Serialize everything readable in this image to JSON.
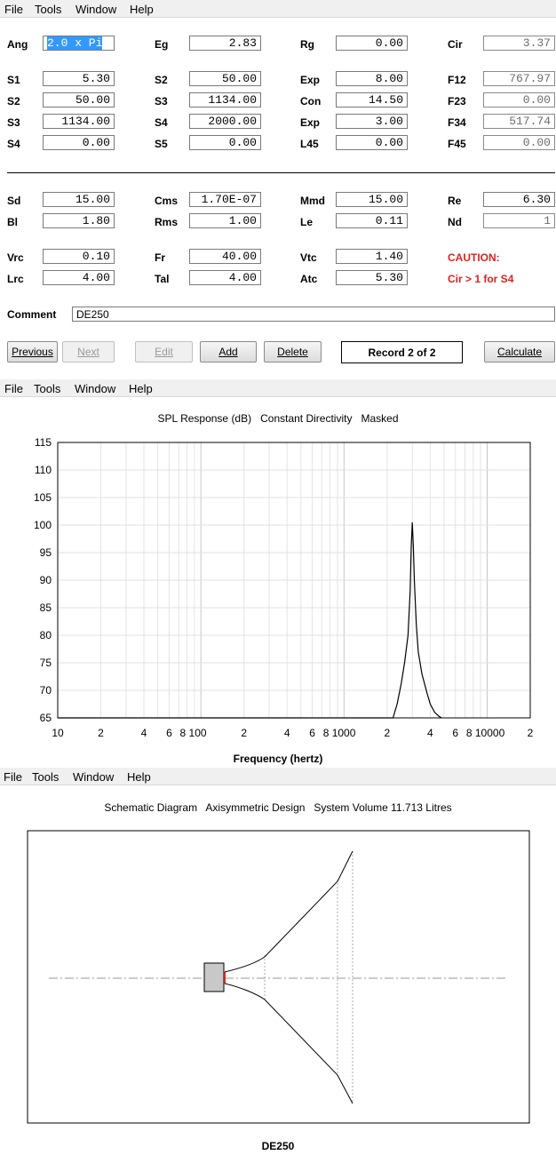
{
  "menu": {
    "file": "File",
    "tools": "Tools",
    "window": "Window",
    "help": "Help"
  },
  "form": {
    "rows": [
      [
        [
          "Ang",
          "2.0 x Pi"
        ],
        [
          "Eg",
          "2.83"
        ],
        [
          "Rg",
          "0.00"
        ],
        [
          "Cir",
          "3.37"
        ]
      ],
      [
        [
          "S1",
          "5.30"
        ],
        [
          "S2",
          "50.00"
        ],
        [
          "Exp",
          "8.00"
        ],
        [
          "F12",
          "767.97"
        ]
      ],
      [
        [
          "S2",
          "50.00"
        ],
        [
          "S3",
          "1134.00"
        ],
        [
          "Con",
          "14.50"
        ],
        [
          "F23",
          "0.00"
        ]
      ],
      [
        [
          "S3",
          "1134.00"
        ],
        [
          "S4",
          "2000.00"
        ],
        [
          "Exp",
          "3.00"
        ],
        [
          "F34",
          "517.74"
        ]
      ],
      [
        [
          "S4",
          "0.00"
        ],
        [
          "S5",
          "0.00"
        ],
        [
          "L45",
          "0.00"
        ],
        [
          "F45",
          "0.00"
        ]
      ],
      [
        [
          "Sd",
          "15.00"
        ],
        [
          "Cms",
          "1.70E-07"
        ],
        [
          "Mmd",
          "15.00"
        ],
        [
          "Re",
          "6.30"
        ]
      ],
      [
        [
          "Bl",
          "1.80"
        ],
        [
          "Rms",
          "1.00"
        ],
        [
          "Le",
          "0.11"
        ],
        [
          "Nd",
          "1"
        ]
      ],
      [
        [
          "Vrc",
          "0.10"
        ],
        [
          "Fr",
          "40.00"
        ],
        [
          "Vtc",
          "1.40"
        ]
      ],
      [
        [
          "Lrc",
          "4.00"
        ],
        [
          "Tal",
          "4.00"
        ],
        [
          "Atc",
          "5.30"
        ]
      ]
    ],
    "caution_title": "CAUTION:",
    "caution_msg": "Cir > 1 for S4",
    "comment_label": "Comment",
    "comment_value": "DE250",
    "buttons": {
      "previous": "Previous",
      "next": "Next",
      "edit": "Edit",
      "add": "Add",
      "delete": "Delete",
      "calculate": "Calculate"
    },
    "record": "Record 2 of 2"
  },
  "chart_data": {
    "type": "line",
    "title": "SPL Response (dB)   Constant Directivity   Masked",
    "xlabel": "Frequency (hertz)",
    "ylabel": "",
    "xscale": "log",
    "xlim": [
      10,
      20000
    ],
    "ylim": [
      65,
      115
    ],
    "ytick_labels": [
      "115",
      "110",
      "105",
      "100",
      "95",
      "90",
      "85",
      "80",
      "75",
      "70",
      "65"
    ],
    "yticks": [
      115,
      110,
      105,
      100,
      95,
      90,
      85,
      80,
      75,
      70,
      65
    ],
    "xtick_labels": [
      "10",
      "2",
      "4",
      "6",
      "8 100",
      "2",
      "4",
      "6",
      "8 1000",
      "2",
      "4",
      "6",
      "8 10000",
      "2"
    ],
    "xticks": [
      10,
      20,
      40,
      60,
      80,
      200,
      400,
      600,
      800,
      2000,
      4000,
      6000,
      8000,
      20000
    ],
    "series": [
      {
        "x": [
          10,
          2200,
          2350,
          2500,
          2650,
          2800,
          2900,
          2950,
          3000,
          3050,
          3100,
          3200,
          3300,
          3500,
          3800,
          4000,
          4300,
          4600,
          4800
        ],
        "y": [
          65,
          65,
          67.5,
          71,
          75,
          80,
          88,
          96,
          100.5,
          96,
          90,
          82,
          77,
          73,
          69.5,
          67.5,
          66,
          65.3,
          65
        ]
      }
    ],
    "grid": true
  },
  "schematic": {
    "title": "Schematic Diagram   Axisymmetric Design   System Volume 11.713 Litres",
    "caption": "DE250"
  }
}
